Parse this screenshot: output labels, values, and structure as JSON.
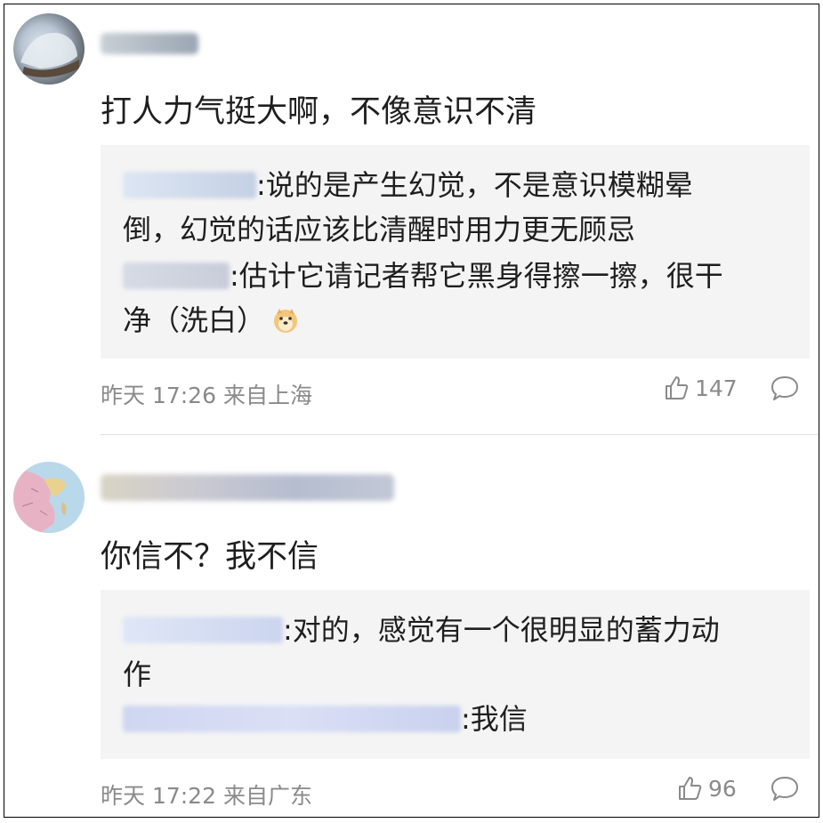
{
  "comments": [
    {
      "text": "打人力气挺大啊，不像意识不清",
      "replies": [
        {
          "text_line1": ":说的是产生幻觉，不是意识模糊晕",
          "text_line2": "倒，幻觉的话应该比清醒时用力更无顾忌"
        },
        {
          "text_line1": ":估计它请记者帮它黑身得擦一擦，很干",
          "text_line2": "净（洗白）"
        }
      ],
      "time": "昨天 17:26 来自上海",
      "likes": "147",
      "emoji": "doge-emoji"
    },
    {
      "text": "你信不？我不信",
      "replies": [
        {
          "text_line1": ":对的，感觉有一个很明显的蓄力动",
          "text_line2": "作"
        },
        {
          "text_line1": ":我信"
        }
      ],
      "time": "昨天 17:22 来自广东",
      "likes": "96"
    }
  ],
  "icons": {
    "like": "thumbs-up-icon",
    "reply": "comment-bubble-icon"
  },
  "colors": {
    "meta": "#8a8a8a",
    "reply_bg": "#f4f4f4",
    "text": "#1e1e1e"
  }
}
